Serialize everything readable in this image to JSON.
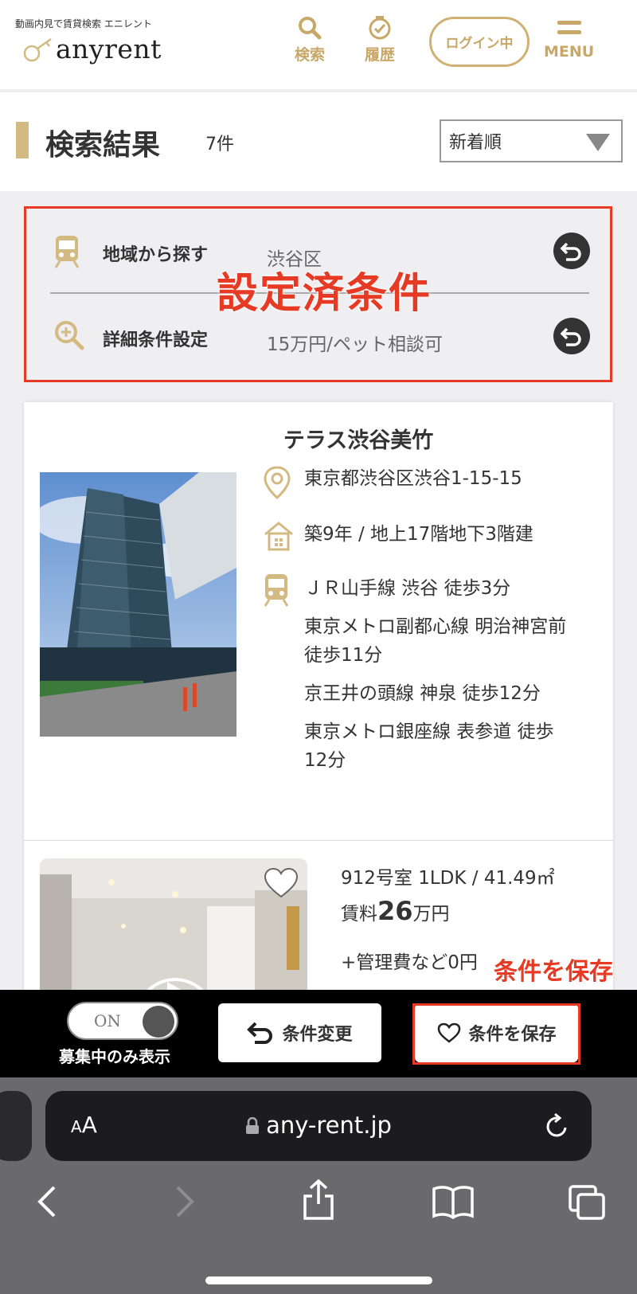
{
  "header": {
    "logo_sub": "動画内見で賃貸検索 エニレント",
    "logo_main": "anyrent",
    "nav": {
      "search": "検索",
      "history": "履歴",
      "login": "ログイン中",
      "menu": "MENU"
    }
  },
  "results": {
    "title": "検索結果",
    "count": "7件",
    "sort_selected": "新着順"
  },
  "conditions": {
    "rows": [
      {
        "label": "地域から探す",
        "value": "渋谷区",
        "icon": "train-icon"
      },
      {
        "label": "詳細条件設定",
        "value": "15万円/ペット相談可",
        "icon": "zoom-plus-icon"
      }
    ],
    "overlay": "設定済条件"
  },
  "property": {
    "name": "テラス渋谷美竹",
    "address": "東京都渋谷区渋谷1-15-15",
    "building": "築9年 / 地上17階地下3階建",
    "access": [
      "ＪＲ山手線 渋谷 徒歩3分",
      "東京メトロ副都心線 明治神宮前",
      "徒歩11分",
      "京王井の頭線 神泉 徒歩12分",
      "東京メトロ銀座線 表参道 徒歩",
      "12分"
    ],
    "room": {
      "spec": "912号室 1LDK / 41.49㎡",
      "rent_label": "賃料",
      "rent_value": "26",
      "rent_unit": "万円",
      "fees": "+管理費など0円"
    }
  },
  "annotations": {
    "save": "条件を保存"
  },
  "action_bar": {
    "toggle_text": "ON",
    "toggle_label": "募集中のみ表示",
    "change_button": "条件変更",
    "save_button": "条件を保存"
  },
  "browser": {
    "aa_small": "A",
    "aa_large": "A",
    "url": "any-rent.jp"
  },
  "colors": {
    "gold": "#c8a868",
    "accent_red": "#e63a24",
    "dark": "#333333"
  }
}
